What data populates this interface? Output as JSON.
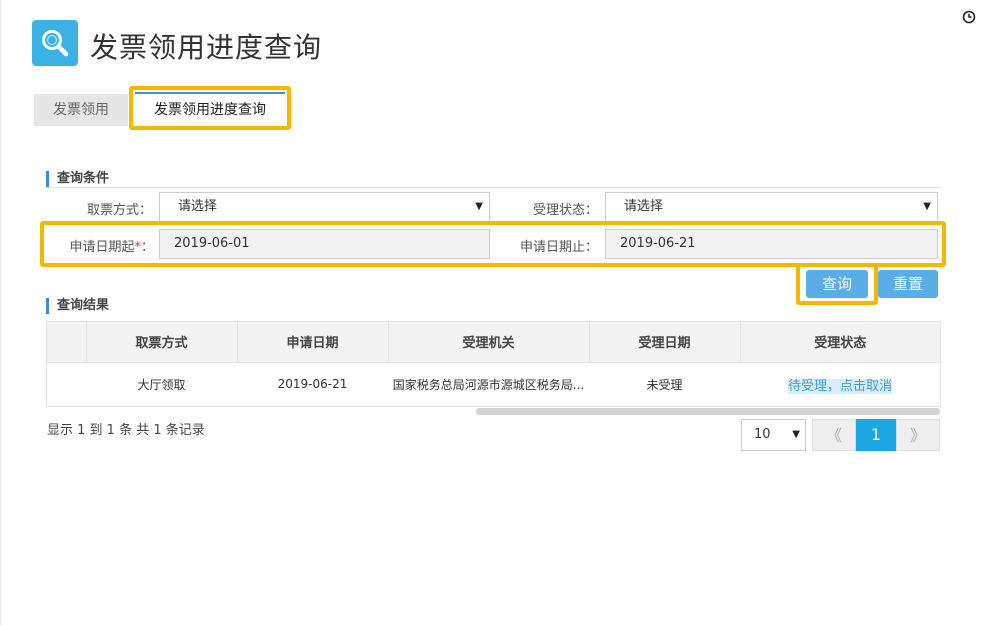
{
  "header": {
    "title": "发票领用进度查询",
    "logo_icon": "search-icon",
    "clock_icon": "clock-icon"
  },
  "tabs": [
    {
      "label": "发票领用",
      "active": false
    },
    {
      "label": "发票领用进度查询",
      "active": true
    }
  ],
  "conditions": {
    "section_title": "查询条件",
    "ticket_method": {
      "label": "取票方式：",
      "value": "请选择"
    },
    "accept_status": {
      "label": "受理状态：",
      "value": "请选择"
    },
    "date_from": {
      "label": "申请日期起",
      "required_mark": "*",
      "colon": "：",
      "value": "2019-06-01"
    },
    "date_to": {
      "label": "申请日期止：",
      "value": "2019-06-21"
    }
  },
  "buttons": {
    "query": "查询",
    "reset": "重置"
  },
  "results": {
    "section_title": "查询结果",
    "columns": [
      "",
      "取票方式",
      "申请日期",
      "受理机关",
      "受理日期",
      "受理状态"
    ],
    "rows": [
      {
        "index": "",
        "ticket_method": "大厅领取",
        "apply_date": "2019-06-21",
        "authority": "国家税务总局河源市源城区税务局...",
        "accept_date": "未受理",
        "status": "待受理，点击取消"
      }
    ],
    "record_info": "显示 1 到 1 条 共 1 条记录"
  },
  "pagination": {
    "page_size": "10",
    "prev": "《",
    "current": "1",
    "next": "》"
  },
  "colors": {
    "accent": "#3bb2e6",
    "highlight": "#f5b800",
    "button": "#5aaee8",
    "pager_active": "#1aa7e2"
  }
}
